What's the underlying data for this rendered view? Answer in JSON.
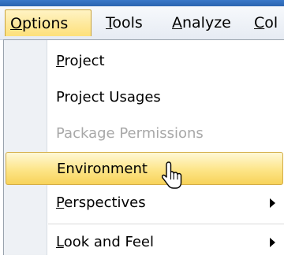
{
  "menubar": {
    "items": [
      {
        "label": "Options",
        "accel": "O",
        "rest": "ptions",
        "open": true
      },
      {
        "label": "Tools",
        "accel": "T",
        "rest": "ools"
      },
      {
        "label": "Analyze",
        "accel": "A",
        "rest": "nalyze"
      },
      {
        "label": "Col",
        "accel": "C",
        "rest": "ol"
      }
    ]
  },
  "dropdown": {
    "items": [
      {
        "label": "Project",
        "accel": "P",
        "rest": "roject",
        "enabled": true
      },
      {
        "label": "Project Usages",
        "enabled": true
      },
      {
        "label": "Package Permissions",
        "enabled": false
      },
      {
        "label": "Environment",
        "enabled": true,
        "highlighted": true
      },
      {
        "label": "Perspectives",
        "accel": "P",
        "rest": "erspectives",
        "enabled": true,
        "submenu": true
      },
      {
        "label": "Look and Feel",
        "accel": "L",
        "rest": "ook and Feel",
        "enabled": true,
        "submenu": true
      }
    ]
  }
}
